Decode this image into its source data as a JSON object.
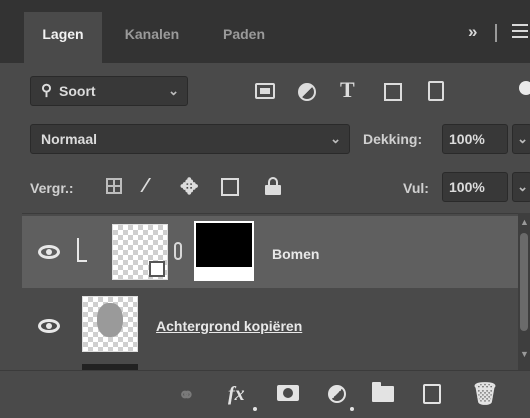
{
  "tabs": [
    {
      "label": "Lagen",
      "active": true
    },
    {
      "label": "Kanalen",
      "active": false
    },
    {
      "label": "Paden",
      "active": false
    }
  ],
  "tab_controls": {
    "collapse_icon": "double-chevron-right-icon",
    "menu_icon": "panel-menu-icon"
  },
  "filter": {
    "label": "Soort",
    "icons": [
      "pixel-filter-icon",
      "adjustment-filter-icon",
      "type-filter-icon",
      "shape-filter-icon",
      "smart-object-filter-icon"
    ]
  },
  "blend": {
    "mode": "Normaal",
    "opacity_label": "Dekking:",
    "opacity_value": "100%"
  },
  "lock": {
    "label": "Vergr.:",
    "fill_label": "Vul:",
    "fill_value": "100%",
    "icons": [
      "lock-transparency-icon",
      "lock-image-icon",
      "lock-position-icon",
      "lock-artboard-icon",
      "lock-all-icon"
    ]
  },
  "layers": [
    {
      "name": "Bomen",
      "visible": true,
      "selected": true,
      "clipped": true,
      "has_mask": true
    },
    {
      "name": "Achtergrond kopiëren",
      "visible": true,
      "selected": false
    }
  ],
  "bottom_bar": {
    "icons": [
      "link-layers-icon",
      "fx-icon",
      "add-mask-icon",
      "adjustment-layer-icon",
      "group-folder-icon",
      "new-layer-icon",
      "trash-icon"
    ],
    "fx_label": "fx"
  },
  "colors": {
    "panel": "#4a4a4a",
    "tabbar": "#333333",
    "selected_row": "#5f5f5f",
    "field": "#383838"
  }
}
